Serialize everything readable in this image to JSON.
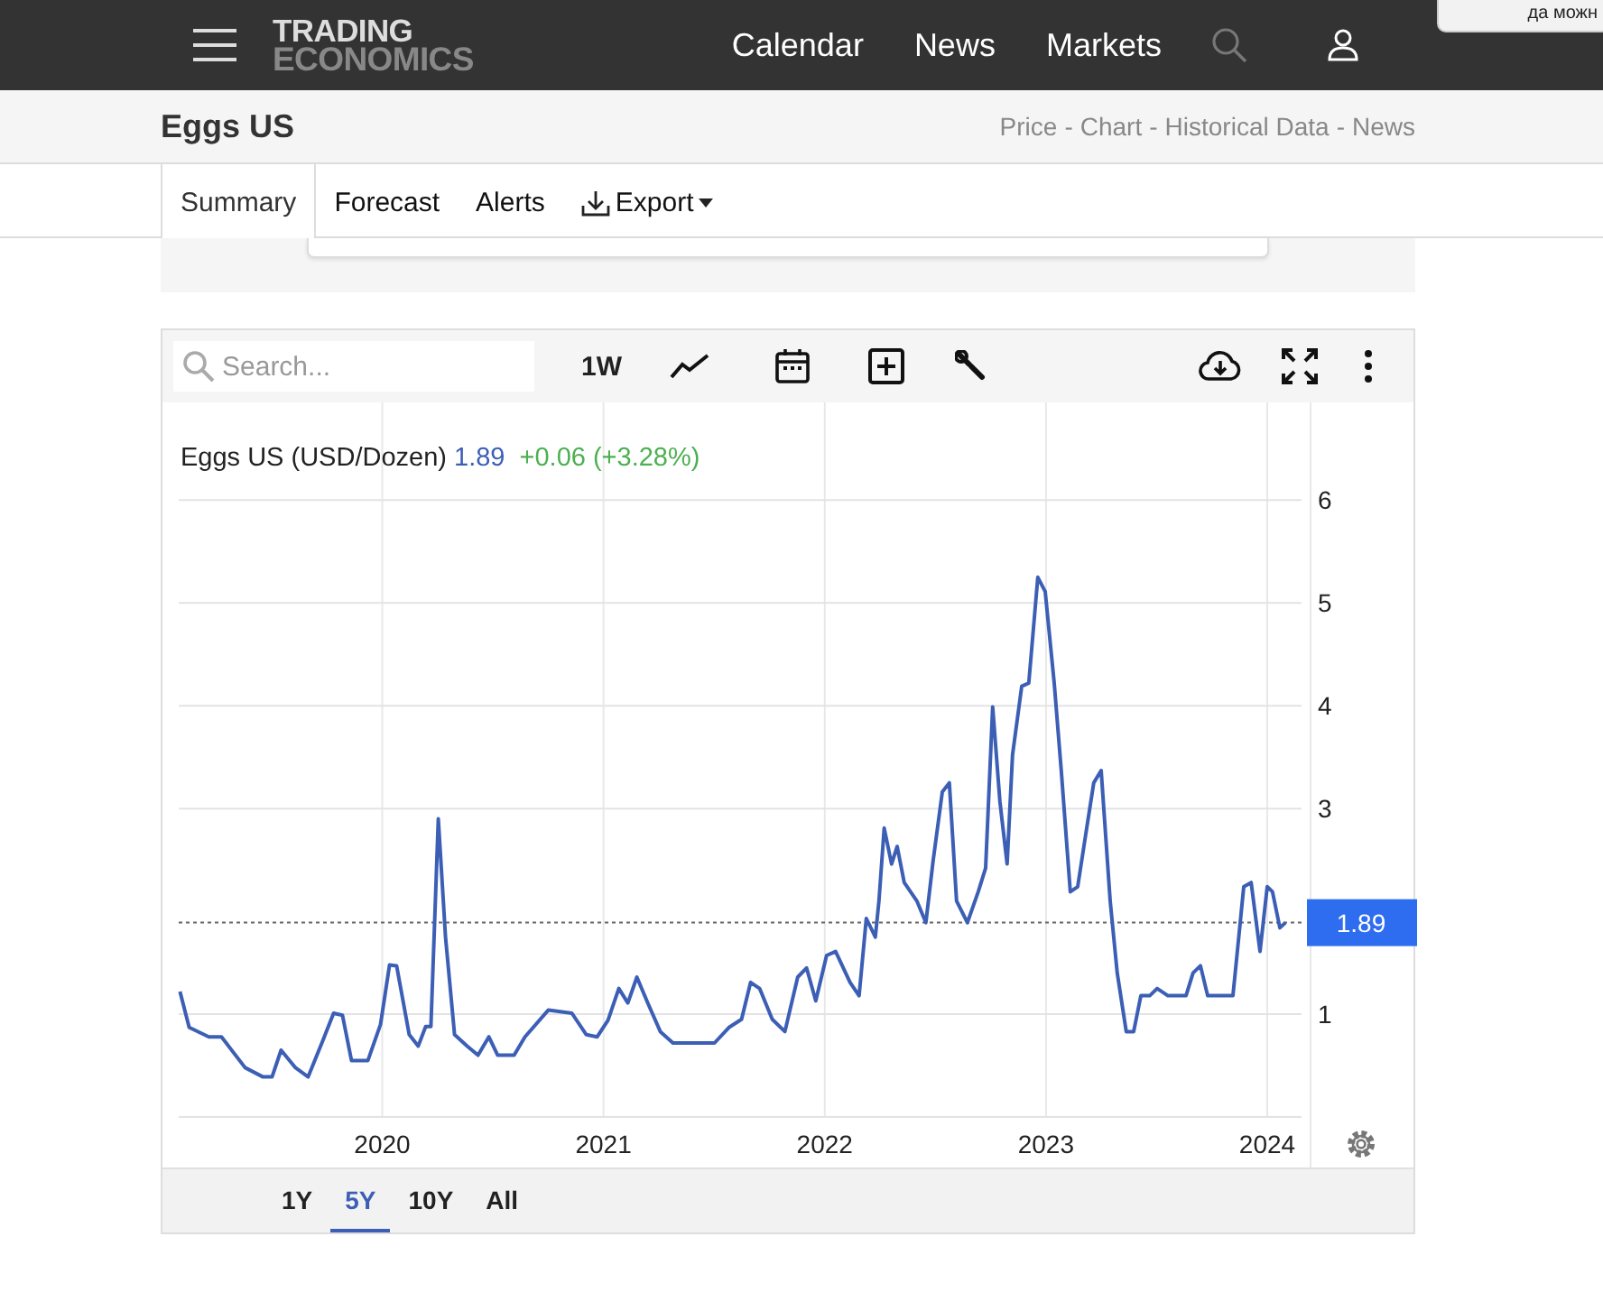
{
  "header": {
    "logo_top": "TRADING",
    "logo_bottom": "ECONOMICS",
    "nav": [
      "Calendar",
      "News",
      "Markets"
    ]
  },
  "popup": {
    "text": "да можн"
  },
  "title_bar": {
    "title": "Eggs US",
    "separator": "-",
    "links": [
      "Price",
      "Chart",
      "Historical Data",
      "News"
    ]
  },
  "tabs": [
    {
      "label": "Summary",
      "selected": true,
      "kind": "tab"
    },
    {
      "label": "Forecast",
      "selected": false,
      "kind": "tab"
    },
    {
      "label": "Alerts",
      "selected": false,
      "kind": "tab"
    },
    {
      "label": "Export",
      "selected": false,
      "kind": "dropdown"
    }
  ],
  "toolbar": {
    "search_placeholder": "Search...",
    "interval": "1W"
  },
  "chart": {
    "series_name": "Eggs US (USD/Dozen)",
    "last": "1.89",
    "change": "+0.06 (+3.28%)",
    "chart_data": {
      "type": "line",
      "x": [
        2019.086,
        2019.127,
        2019.216,
        2019.273,
        2019.38,
        2019.461,
        2019.502,
        2019.543,
        2019.608,
        2019.665,
        2019.731,
        2019.78,
        2019.82,
        2019.861,
        2019.935,
        2019.992,
        2020.033,
        2020.065,
        2020.122,
        2020.163,
        2020.196,
        2020.22,
        2020.253,
        2020.286,
        2020.327,
        2020.384,
        2020.433,
        2020.482,
        2020.522,
        2020.596,
        2020.645,
        2020.751,
        2020.857,
        2020.922,
        2020.971,
        2021.02,
        2021.069,
        2021.11,
        2021.151,
        2021.2,
        2021.257,
        2021.314,
        2021.502,
        2021.567,
        2021.624,
        2021.665,
        2021.706,
        2021.763,
        2021.82,
        2021.878,
        2021.918,
        2021.959,
        2022.008,
        2022.049,
        2022.114,
        2022.155,
        2022.188,
        2022.229,
        2022.245,
        2022.269,
        2022.302,
        2022.327,
        2022.359,
        2022.416,
        2022.457,
        2022.49,
        2022.531,
        2022.563,
        2022.596,
        2022.645,
        2022.694,
        2022.727,
        2022.759,
        2022.792,
        2022.824,
        2022.849,
        2022.89,
        2022.922,
        2022.963,
        2022.996,
        2023.037,
        2023.069,
        2023.11,
        2023.143,
        2023.184,
        2023.216,
        2023.249,
        2023.29,
        2023.322,
        2023.363,
        2023.396,
        2023.429,
        2023.469,
        2023.502,
        2023.551,
        2023.633,
        2023.665,
        2023.698,
        2023.731,
        2023.845,
        2023.894,
        2023.927,
        2023.967,
        2024.0,
        2024.024,
        2024.057,
        2024.082
      ],
      "values": [
        1.22,
        0.87,
        0.78,
        0.78,
        0.48,
        0.39,
        0.39,
        0.65,
        0.48,
        0.39,
        0.74,
        1.01,
        0.99,
        0.55,
        0.55,
        0.9,
        1.48,
        1.47,
        0.8,
        0.69,
        0.88,
        0.88,
        2.9,
        1.75,
        0.8,
        0.69,
        0.6,
        0.78,
        0.6,
        0.6,
        0.78,
        1.04,
        1.01,
        0.8,
        0.78,
        0.94,
        1.25,
        1.11,
        1.36,
        1.11,
        0.83,
        0.72,
        0.72,
        0.87,
        0.95,
        1.31,
        1.25,
        0.95,
        0.83,
        1.36,
        1.45,
        1.13,
        1.57,
        1.61,
        1.31,
        1.18,
        1.93,
        1.75,
        2.1,
        2.81,
        2.46,
        2.63,
        2.28,
        2.1,
        1.89,
        2.49,
        3.16,
        3.25,
        2.1,
        1.89,
        2.19,
        2.42,
        3.99,
        3.07,
        2.46,
        3.52,
        4.19,
        4.22,
        5.25,
        5.11,
        4.22,
        3.37,
        2.19,
        2.24,
        2.81,
        3.25,
        3.37,
        2.1,
        1.4,
        0.83,
        0.83,
        1.18,
        1.18,
        1.25,
        1.18,
        1.18,
        1.4,
        1.47,
        1.18,
        1.18,
        2.24,
        2.28,
        1.61,
        2.24,
        2.19,
        1.84,
        1.89
      ],
      "xlim": [
        2019.08,
        2024.155
      ],
      "ylim": [
        0,
        6.95
      ],
      "xticks": [
        2020,
        2021,
        2022,
        2023,
        2024
      ],
      "yticks": [
        1,
        3,
        4,
        5,
        6
      ],
      "grid": true,
      "ref_lines": [
        {
          "axis": "y",
          "value": 1.89,
          "label": "1.89"
        }
      ]
    }
  },
  "ranges": [
    {
      "label": "1Y",
      "selected": false
    },
    {
      "label": "5Y",
      "selected": true
    },
    {
      "label": "10Y",
      "selected": false
    },
    {
      "label": "All",
      "selected": false
    }
  ]
}
